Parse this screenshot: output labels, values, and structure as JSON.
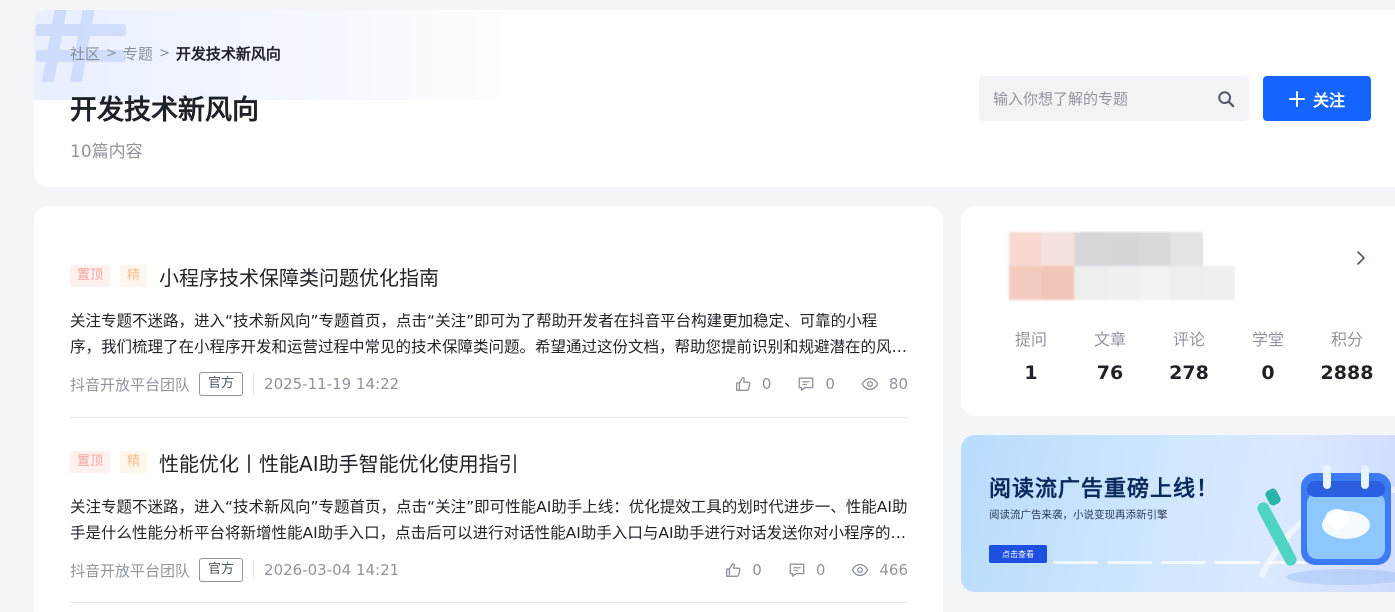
{
  "breadcrumb": {
    "items": [
      "社区",
      "专题"
    ],
    "separator": ">",
    "current": "开发技术新风向"
  },
  "header": {
    "title": "开发技术新风向",
    "count": "10篇内容",
    "search_placeholder": "输入你想了解的专题",
    "follow_label": "关注"
  },
  "articles": [
    {
      "tag_top": "置顶",
      "tag_best": "精",
      "title": "小程序技术保障类问题优化指南",
      "summary": "关注专题不迷路，进入“技术新风向”专题首页，点击“关注”即可为了帮助开发者在抖音平台构建更加稳定、可靠的小程序，我们梳理了在小程序开发和运营过程中常见的技术保障类问题。希望通过这份文档，帮助您提前识别和规避潜在的风险。",
      "author": "抖音开放平台团队",
      "badge": "官方",
      "time": "2025-11-19 14:22",
      "likes": "0",
      "comments": "0",
      "views": "80"
    },
    {
      "tag_top": "置顶",
      "tag_best": "精",
      "title": "性能优化丨性能AI助手智能优化使用指引",
      "summary": "关注专题不迷路，进入“技术新风向”专题首页，点击“关注”即可性能AI助手上线：优化提效工具的划时代进步一、性能AI助手是什么性能分析平台将新增性能AI助手入口，点击后可以进行对话性能AI助手入口与AI助手进行对话发送你对小程序的优化诉求。",
      "author": "抖音开放平台团队",
      "badge": "官方",
      "time": "2026-03-04 14:21",
      "likes": "0",
      "comments": "0",
      "views": "466"
    }
  ],
  "profile": {
    "stats": [
      {
        "label": "提问",
        "value": "1"
      },
      {
        "label": "文章",
        "value": "76"
      },
      {
        "label": "评论",
        "value": "278"
      },
      {
        "label": "学堂",
        "value": "0"
      },
      {
        "label": "积分",
        "value": "2888"
      }
    ],
    "avatar_colors": [
      "#f7d9d2",
      "#f6e2dc",
      "#d7d7d9",
      "#d6d6d8",
      "#d9d9db",
      "#e3e3e5",
      "#ffffff",
      "#f4cbbf",
      "#f0c6b8",
      "#eeeeef",
      "#f0f0f1",
      "#f2f2f3",
      "#eeeeef",
      "#efeff0"
    ]
  },
  "banner": {
    "title": "阅读流广告重磅上线！",
    "subtitle": "阅读流广告来袭，小说变现再添新引擎",
    "button_label": "点击查看",
    "active_dot": 3
  },
  "colors": {
    "primary": "#1664ff",
    "tag_top_text": "#f5a59a",
    "tag_best_text": "#f7c08f",
    "muted": "#8f959e"
  }
}
